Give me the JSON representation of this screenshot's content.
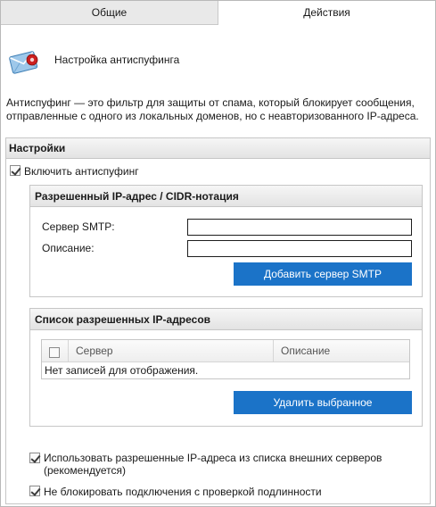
{
  "tabs": [
    {
      "label": "Общие",
      "active": false
    },
    {
      "label": "Действия",
      "active": true
    }
  ],
  "header": {
    "icon": "email-shield-icon",
    "title": "Настройка антиспуфинга"
  },
  "description": "Антиспуфинг — это фильтр для защиты от спама, который блокирует сообщения, отправленные с одного из локальных доменов, но с неавторизованного IP-адреса.",
  "settings": {
    "title": "Настройки",
    "enable_label": "Включить антиспуфинг",
    "enable_checked": true,
    "ip_panel": {
      "title": "Разрешенный IP-адрес / CIDR-нотация",
      "smtp_label": "Сервер SMTP:",
      "smtp_value": "",
      "desc_label": "Описание:",
      "desc_value": "",
      "add_button": "Добавить сервер SMTP"
    },
    "list_panel": {
      "title": "Список разрешенных IP-адресов",
      "columns": [
        "Сервер",
        "Описание"
      ],
      "empty_text": "Нет записей для отображения.",
      "delete_button": "Удалить выбранное"
    },
    "use_external_label": "Использовать разрешенные IP-адреса из списка внешних серверов (рекомендуется)",
    "use_external_checked": true,
    "no_block_label": "Не блокировать подключения с проверкой подлинности",
    "no_block_checked": true
  },
  "colors": {
    "button": "#1b73c8",
    "panel_header": "#e3e3e3",
    "border": "#c6c6c6"
  }
}
